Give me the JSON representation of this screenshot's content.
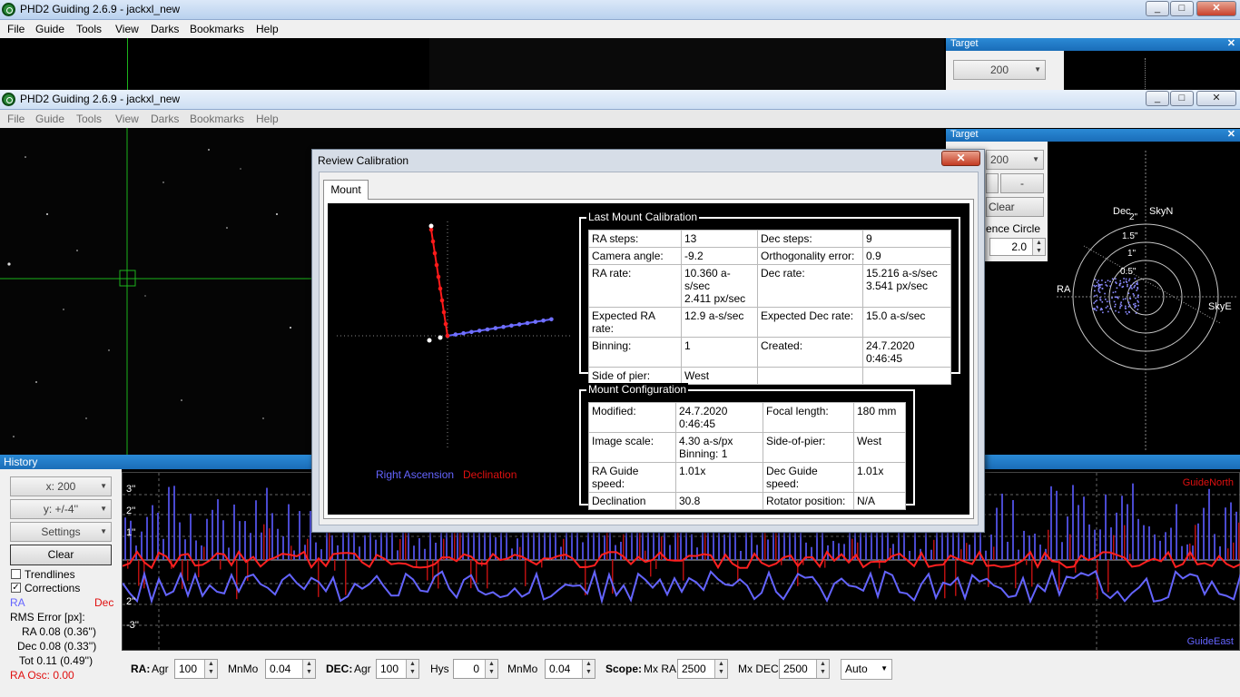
{
  "window_back": {
    "title": "PHD2 Guiding 2.6.9 - jackxl_new",
    "menu": [
      "File",
      "Guide",
      "Tools",
      "View",
      "Darks",
      "Bookmarks",
      "Help"
    ],
    "target_title": "Target",
    "target_combo": "200"
  },
  "window_front": {
    "title": "PHD2 Guiding 2.6.9 - jackxl_new",
    "menu": [
      "File",
      "Guide",
      "Tools",
      "View",
      "Darks",
      "Bookmarks",
      "Help"
    ],
    "win_buttons": [
      "_",
      "□",
      "✕"
    ]
  },
  "target": {
    "title": "Target",
    "combo": "200",
    "minus": "-",
    "clear": "Clear",
    "circle_label": "ence Circle",
    "circle_value": "2.0",
    "labels": {
      "dec": "Dec",
      "skyn": "SkyN",
      "ra": "RA",
      "skye": "SkyE"
    },
    "rings": [
      "2\"",
      "1.5\"",
      "1\"",
      "0.5\""
    ]
  },
  "dialog": {
    "title": "Review Calibration",
    "close": "✕",
    "tab": "Mount",
    "legend_ra": "Right Ascension",
    "legend_dec": "Declination",
    "last_calib": {
      "title": "Last Mount Calibration",
      "rows": [
        [
          "RA steps:",
          "13",
          "Dec steps:",
          "9"
        ],
        [
          "Camera angle:",
          "-9.2",
          "Orthogonality error:",
          "0.9"
        ],
        [
          "RA rate:",
          "10.360 a-s/sec",
          "Dec rate:",
          "15.216 a-s/sec"
        ],
        [
          "Expected RA rate:",
          "12.9 a-s/sec",
          "Expected Dec rate:",
          "15.0 a-s/sec"
        ],
        [
          "Binning:",
          "1",
          "Created:",
          "24.7.2020 0:46:45"
        ],
        [
          "Side of pier:",
          "West",
          "",
          ""
        ]
      ],
      "ra_rate_px": "2.411 px/sec",
      "dec_rate_px": "3.541 px/sec"
    },
    "mount_config": {
      "title": "Mount Configuration",
      "rows": [
        [
          "Modified:",
          "24.7.2020 0:46:45",
          "Focal length:",
          "180 mm"
        ],
        [
          "Image scale:",
          "4.30 a-s/px",
          "Side-of-pier:",
          "West"
        ],
        [
          "RA Guide speed:",
          "1.01x",
          "Dec Guide speed:",
          "1.01x"
        ],
        [
          "Declination",
          "30.8",
          "Rotator position:",
          "N/A"
        ]
      ],
      "binning": "Binning: 1"
    }
  },
  "history": {
    "title": "History",
    "x_combo": "x: 200",
    "y_combo": "y: +/-4''",
    "settings": "Settings",
    "clear": "Clear",
    "trendlines": "Trendlines",
    "corrections": "Corrections",
    "ra": "RA",
    "dec": "Dec",
    "rms_title": "RMS Error [px]:",
    "rms_ra": "RA  0.08 (0.36'')",
    "rms_dec": "Dec  0.08 (0.33'')",
    "rms_tot": "Tot  0.11 (0.49'')",
    "ra_osc": "RA Osc: 0.00",
    "guide_north": "GuideNorth",
    "guide_east": "GuideEast",
    "y_ticks": [
      "3''",
      "2''",
      "1''",
      "2''",
      "-3''"
    ],
    "colors": {
      "ra": "#6464ff",
      "dec": "#ff2020"
    }
  },
  "controls": {
    "ra_label": "RA:",
    "agr": "Agr",
    "ra_agr": "100",
    "mnmo": "MnMo",
    "ra_mnmo": "0.04",
    "dec_label": "DEC:",
    "dec_agr": "100",
    "hys": "Hys",
    "hys_val": "0",
    "dec_mnmo": "0.04",
    "scope_label": "Scope:",
    "mx_ra": "Mx RA",
    "mx_ra_val": "2500",
    "mx_dec": "Mx DEC",
    "mx_dec_val": "2500",
    "algo": "Auto"
  }
}
